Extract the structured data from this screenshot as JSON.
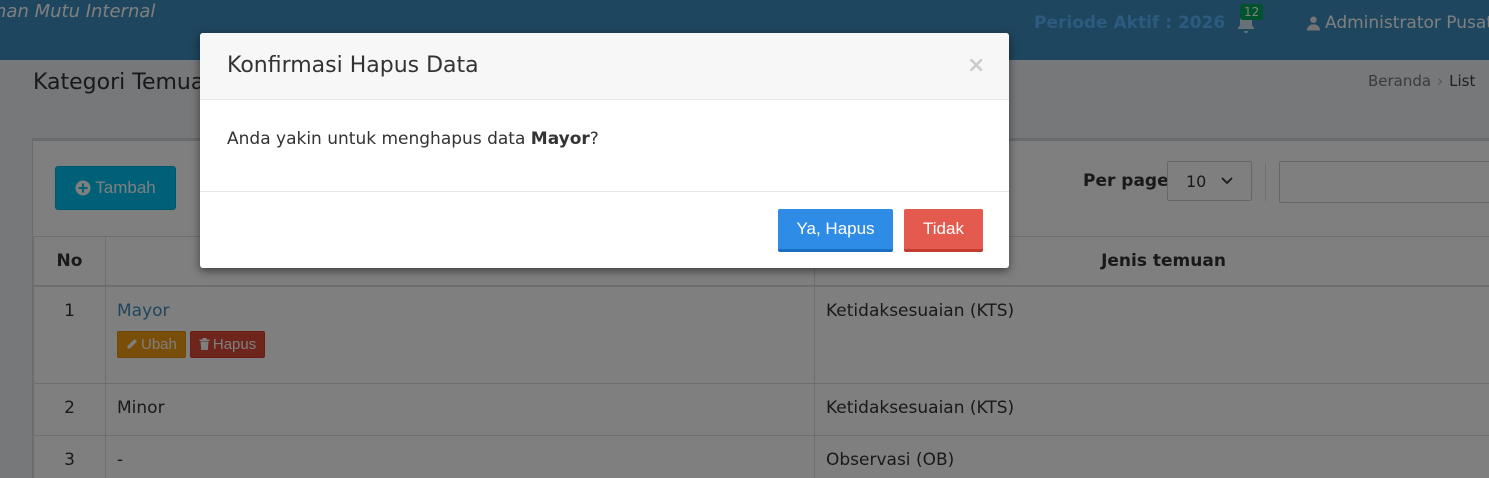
{
  "navbar": {
    "brand": "inan Mutu Internal",
    "periode": "Periode Aktif : 2026",
    "notification_count": "12",
    "user": "Administrator Pusat"
  },
  "header": {
    "title": "Kategori Temuan",
    "breadcrumb_home": "Beranda",
    "breadcrumb_active": "List"
  },
  "toolbar": {
    "add_label": "Tambah",
    "per_page_label": "Per page:",
    "per_page_value": "10",
    "search_placeholder": ""
  },
  "table": {
    "columns": [
      "No",
      "",
      "Jenis temuan"
    ],
    "rows": [
      {
        "no": "1",
        "nama": "Mayor",
        "jenis": "Ketidaksesuaian (KTS)"
      },
      {
        "no": "2",
        "nama": "Minor",
        "jenis": "Ketidaksesuaian (KTS)"
      },
      {
        "no": "3",
        "nama": "-",
        "jenis": "Observasi (OB)"
      }
    ],
    "edit_label": "Ubah",
    "delete_label": "Hapus"
  },
  "modal": {
    "title": "Konfirmasi Hapus Data",
    "close_symbol": "×",
    "message_prefix": "Anda yakin untuk menghapus data ",
    "message_item": "Mayor",
    "message_suffix": "?",
    "confirm_label": "Ya, Hapus",
    "cancel_label": "Tidak"
  }
}
